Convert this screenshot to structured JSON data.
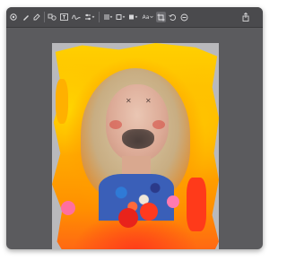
{
  "toolbar": {
    "left_tools": [
      {
        "name": "markup-toggle-icon"
      },
      {
        "name": "pen-icon"
      },
      {
        "name": "highlighter-icon"
      },
      {
        "name": "shapes-icon"
      },
      {
        "name": "text-box-icon"
      },
      {
        "name": "sign-icon"
      },
      {
        "name": "adjust-color-icon"
      },
      {
        "name": "line-style-icon"
      },
      {
        "name": "border-color-icon"
      },
      {
        "name": "fill-color-icon"
      }
    ],
    "text_style_label": "Aa",
    "right_tools": [
      {
        "name": "crop-icon"
      },
      {
        "name": "rotate-icon"
      },
      {
        "name": "share-icon"
      }
    ]
  },
  "colors": {
    "window_bg": "#5b5b5e",
    "toolbar_bg": "#4a4a4d",
    "photo_flame_yellow": "#ffd000",
    "photo_flame_orange": "#ff9000",
    "photo_flame_red": "#ff3b1a"
  }
}
